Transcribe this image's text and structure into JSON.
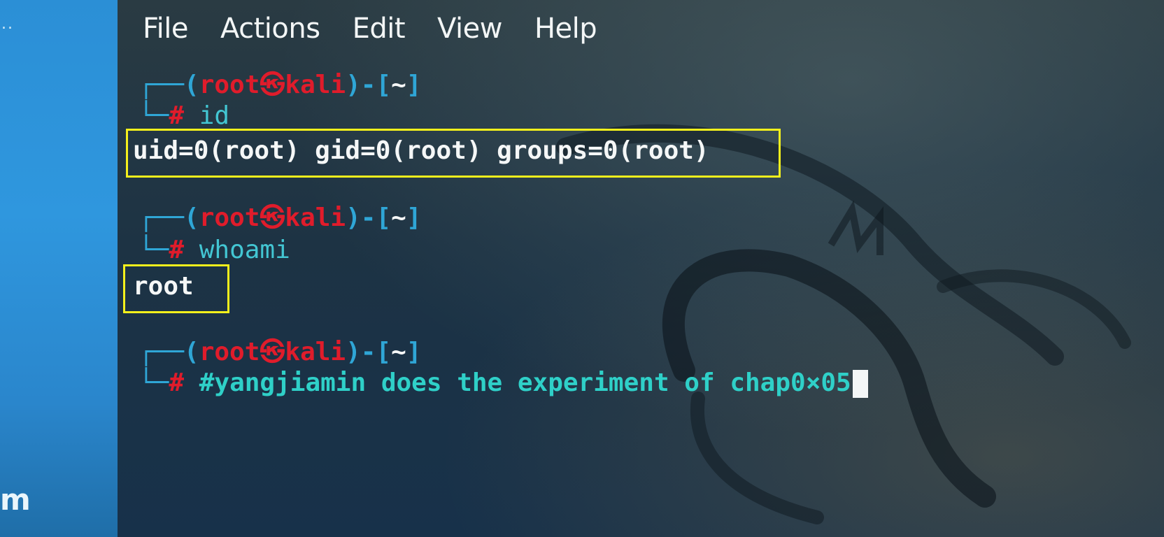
{
  "desktop": {
    "top_dots": "..",
    "bottom_text": "m"
  },
  "menu": {
    "file": "File",
    "actions": "Actions",
    "edit": "Edit",
    "view": "View",
    "help": "Help"
  },
  "terminal": {
    "prompt": {
      "open": "┌──(",
      "user": "root㉿kali",
      "close": ")-[",
      "dir": "~",
      "end": "]",
      "corner": "└─",
      "hash": "#"
    },
    "blocks": [
      {
        "command": "id",
        "output": "uid=0(root) gid=0(root) groups=0(root)"
      },
      {
        "command": "whoami",
        "output": "root"
      },
      {
        "command": "#yangjiamin does the experiment of chap0×05",
        "output": ""
      }
    ]
  },
  "colors": {
    "highlight_box": "#f4f01c",
    "prompt_user": "#e01c2b",
    "prompt_frame": "#2fa6d6",
    "command": "#43c6d3",
    "output": "#f5f7f7"
  }
}
